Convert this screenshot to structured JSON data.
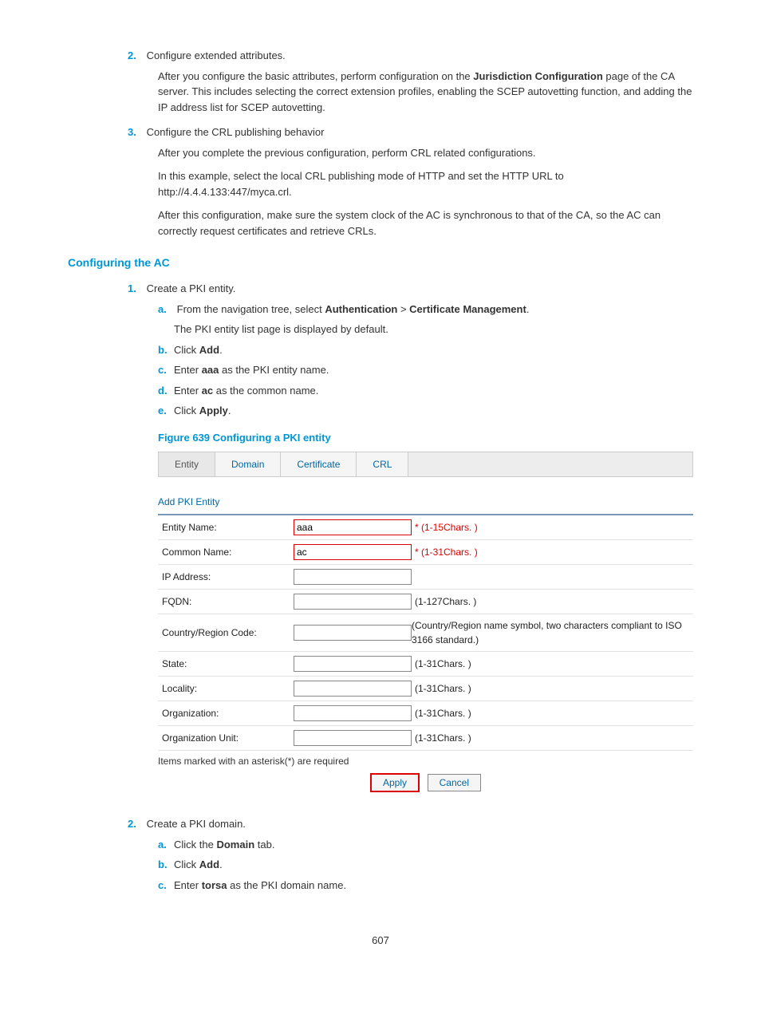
{
  "steps_main": {
    "s2": {
      "num": "2.",
      "title": "Configure extended attributes.",
      "p1a": "After you configure the basic attributes, perform configuration on the ",
      "p1b": "Jurisdiction Configuration",
      "p1c": " page of the CA server. This includes selecting the correct extension profiles, enabling the SCEP autovetting function, and adding the IP address list for SCEP autovetting."
    },
    "s3": {
      "num": "3.",
      "title": "Configure the CRL publishing behavior",
      "p1": "After you complete the previous configuration, perform CRL related configurations.",
      "p2": "In this example, select the local CRL publishing mode of HTTP and set the HTTP URL to http://4.4.4.133:447/myca.crl.",
      "p3": "After this configuration, make sure the system clock of the AC is synchronous to that of the CA, so the AC can correctly request certificates and retrieve CRLs."
    }
  },
  "heading_config_ac": "Configuring the AC",
  "ac_steps": {
    "s1": {
      "num": "1.",
      "title": "Create a PKI entity.",
      "a": {
        "let": "a.",
        "t1": "From the navigation tree, select ",
        "b1": "Authentication",
        "gt": " > ",
        "b2": "Certificate Management",
        "t2": ".",
        "sub": "The PKI entity list page is displayed by default."
      },
      "b": {
        "let": "b.",
        "t1": "Click ",
        "b1": "Add",
        "t2": "."
      },
      "c": {
        "let": "c.",
        "t1": "Enter ",
        "b1": "aaa",
        "t2": " as the PKI entity name."
      },
      "d": {
        "let": "d.",
        "t1": "Enter ",
        "b1": "ac",
        "t2": " as the common name."
      },
      "e": {
        "let": "e.",
        "t1": "Click ",
        "b1": "Apply",
        "t2": "."
      }
    },
    "s2": {
      "num": "2.",
      "title": "Create a PKI domain.",
      "a": {
        "let": "a.",
        "t1": "Click the ",
        "b1": "Domain",
        "t2": " tab."
      },
      "b": {
        "let": "b.",
        "t1": "Click ",
        "b1": "Add",
        "t2": "."
      },
      "c": {
        "let": "c.",
        "t1": "Enter ",
        "b1": "torsa",
        "t2": " as the PKI domain name."
      }
    }
  },
  "figure_caption": "Figure 639 Configuring a PKI entity",
  "tabs": {
    "entity": "Entity",
    "domain": "Domain",
    "certificate": "Certificate",
    "crl": "CRL"
  },
  "form": {
    "title": "Add PKI Entity",
    "rows": {
      "entity_name": {
        "label": "Entity Name:",
        "value": "aaa",
        "hint": "* (1-15Chars. )"
      },
      "common_name": {
        "label": "Common Name:",
        "value": "ac",
        "hint": "* (1-31Chars. )"
      },
      "ip_address": {
        "label": "IP Address:",
        "value": "",
        "hint": ""
      },
      "fqdn": {
        "label": "FQDN:",
        "value": "",
        "hint": "(1-127Chars. )"
      },
      "country": {
        "label": "Country/Region Code:",
        "value": "",
        "hint": "(Country/Region name symbol, two characters compliant to ISO 3166 standard.)"
      },
      "state": {
        "label": "State:",
        "value": "",
        "hint": "(1-31Chars. )"
      },
      "locality": {
        "label": "Locality:",
        "value": "",
        "hint": "(1-31Chars. )"
      },
      "organization": {
        "label": "Organization:",
        "value": "",
        "hint": "(1-31Chars. )"
      },
      "org_unit": {
        "label": "Organization Unit:",
        "value": "",
        "hint": "(1-31Chars. )"
      }
    },
    "note": "Items marked with an asterisk(*) are required",
    "apply": "Apply",
    "cancel": "Cancel"
  },
  "page_number": "607"
}
